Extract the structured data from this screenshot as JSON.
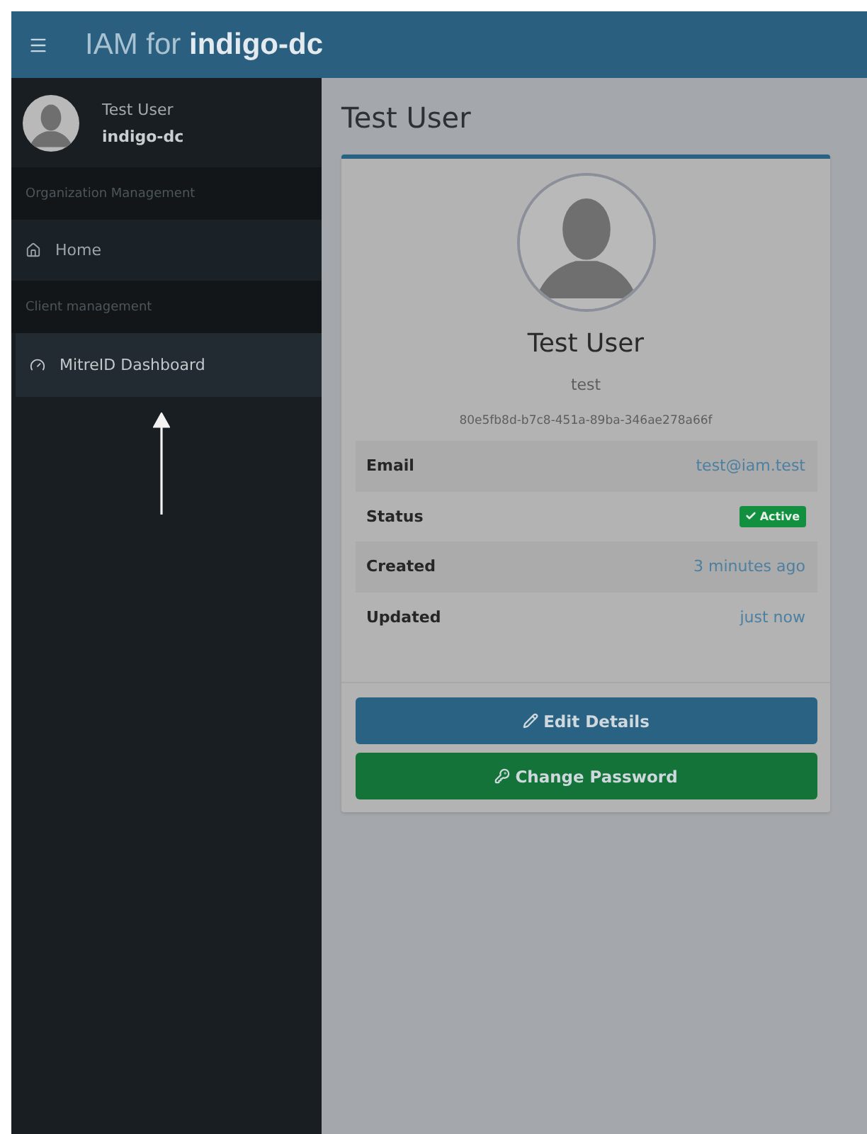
{
  "header": {
    "title": "IAM for **indigo-dc**"
  },
  "sidebar": {
    "user": {
      "name": "Test User",
      "organization": "indigo-dc"
    },
    "sections": [
      {
        "heading": "Organization Management",
        "items": [
          {
            "label": "Home",
            "kind": "home",
            "selected": false
          }
        ]
      },
      {
        "heading": "Client management",
        "items": [
          {
            "label": "MitreID Dashboard",
            "kind": "dashboard",
            "selected": true
          }
        ]
      }
    ]
  },
  "page": {
    "title": "Test User"
  },
  "profile": {
    "name": "Test User",
    "username": "test",
    "uuid": "80e5fb8d-b7c8-451a-89ba-346ae278a66f",
    "details": [
      {
        "label": "Email",
        "kind": "link",
        "value": "test@iam.test"
      },
      {
        "label": "Status",
        "kind": "badge",
        "value": "Active",
        "color": "#129040"
      },
      {
        "label": "Created",
        "kind": "link",
        "value": "3 minutes ago"
      },
      {
        "label": "Updated",
        "kind": "link",
        "value": "just now"
      }
    ],
    "buttons": [
      {
        "label": "Edit Details",
        "kind": "edit"
      },
      {
        "label": "Change Password",
        "kind": "password"
      }
    ]
  }
}
